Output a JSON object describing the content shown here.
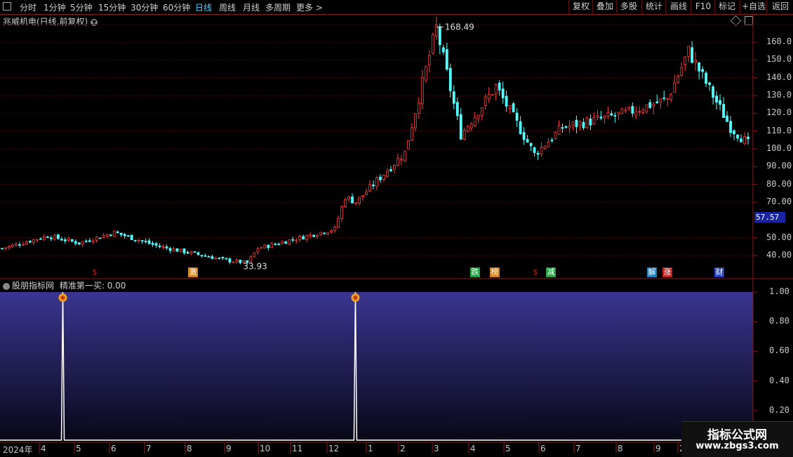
{
  "toolbar": {
    "periods": [
      "分时",
      "1分钟",
      "5分钟",
      "15分钟",
      "30分钟",
      "60分钟",
      "日线",
      "周线",
      "月线",
      "多周期",
      "更多 >"
    ],
    "active_period": "日线",
    "buttons": [
      "复权",
      "叠加",
      "多股",
      "统计",
      "画线",
      "F10",
      "标记",
      "+自选",
      "返回"
    ]
  },
  "chart": {
    "title": "兆威机电(日线,前复权)",
    "y_ticks": [
      "160.0",
      "150.0",
      "140.0",
      "130.0",
      "120.0",
      "110.0",
      "100.0",
      "90.00",
      "80.00",
      "70.00",
      "57.57",
      "50.00",
      "40.00"
    ],
    "current_price": "57.57",
    "high_label": "168.49",
    "low_label": "33.93",
    "badges": [
      {
        "text": "$",
        "color": "#cc2020"
      },
      {
        "text": "激",
        "color": "#d08020"
      },
      {
        "text": "跌",
        "color": "#20a040"
      },
      {
        "text": "榜",
        "color": "#d08020"
      },
      {
        "text": "$",
        "color": "#cc2020"
      },
      {
        "text": "减",
        "color": "#20a040"
      },
      {
        "text": "解",
        "color": "#2080c0"
      },
      {
        "text": "涨",
        "color": "#c02020"
      },
      {
        "text": "财",
        "color": "#2040c0"
      }
    ]
  },
  "indicator": {
    "title": "股朋指标网",
    "label": "精准第一买: 0.00",
    "y_ticks": [
      "1.00",
      "0.80",
      "0.60",
      "0.40",
      "0.20"
    ]
  },
  "dates": [
    "2024年",
    "4",
    "5",
    "6",
    "7",
    "8",
    "9",
    "10",
    "11",
    "12",
    "1",
    "2",
    "3",
    "4",
    "5",
    "6",
    "7",
    "8",
    "9",
    "2"
  ],
  "watermark": {
    "line1": "指标公式网",
    "line2": "www.zbgs3.com"
  },
  "chart_data": {
    "type": "candlestick",
    "title": "兆威机电(日线,前复权)",
    "high": 168.49,
    "low": 33.93,
    "current": 57.57,
    "ylim": [
      33,
      170
    ],
    "x": [
      "2024-03",
      "2024-04",
      "2024-05",
      "2024-06",
      "2024-07",
      "2024-08",
      "2024-09",
      "2024-10",
      "2024-11",
      "2024-12",
      "2025-01",
      "2025-02",
      "2025-03",
      "2025-04",
      "2025-05",
      "2025-06",
      "2025-07",
      "2025-08",
      "2025-09"
    ],
    "close_trend": [
      47,
      44,
      52,
      53,
      47,
      43,
      36,
      47,
      55,
      82,
      72,
      100,
      150,
      105,
      130,
      100,
      112,
      120,
      128,
      140,
      110,
      103
    ],
    "indicator_series": {
      "name": "精准第一买",
      "values_signal_positions": [
        0.08,
        0.47
      ]
    }
  }
}
